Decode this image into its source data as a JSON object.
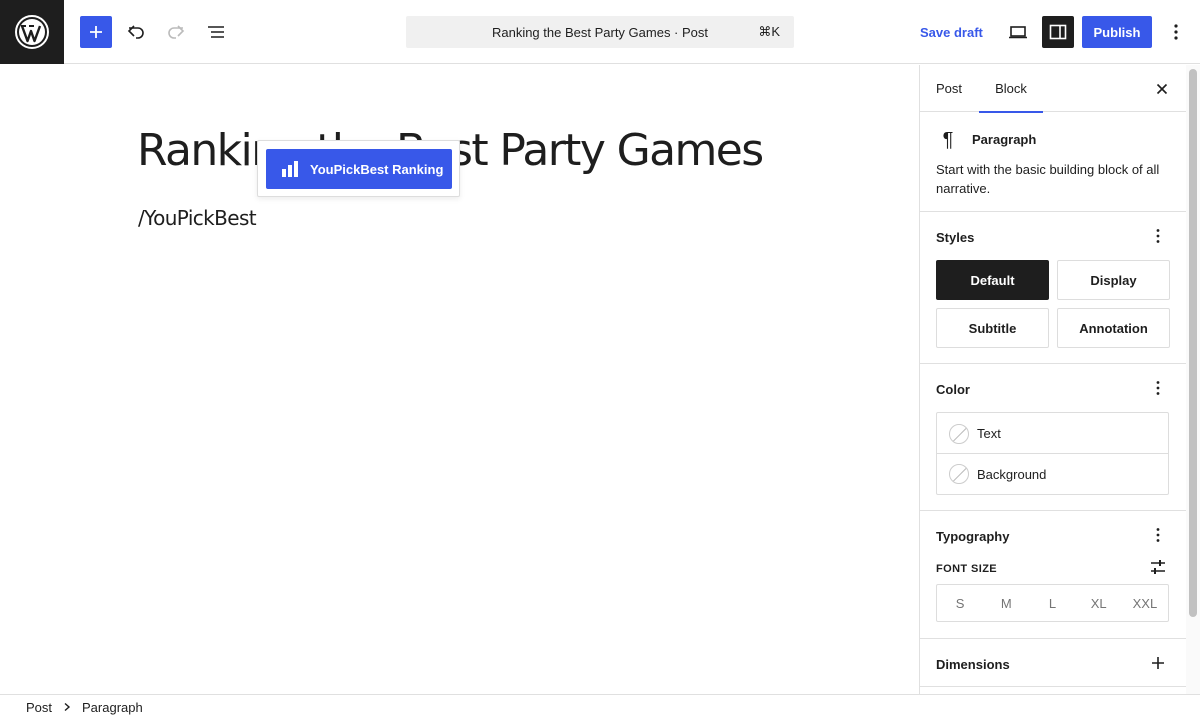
{
  "topbar": {
    "command_title": "Ranking the Best Party Games · Post",
    "shortcut": "⌘K",
    "save_draft": "Save draft",
    "publish": "Publish",
    "icons": [
      "wordpress-logo-icon",
      "plus-icon",
      "undo-icon",
      "redo-icon",
      "list-view-icon",
      "desktop-preview-icon",
      "sidebar-settings-icon",
      "more-vertical-icon"
    ]
  },
  "canvas": {
    "title": "Ranking the Best Party Games",
    "paragraph": "/YouPickBest",
    "inserter": {
      "item_label": "YouPickBest Ranking",
      "item_icon": "bar-chart-icon"
    }
  },
  "sidebar": {
    "tabs": [
      {
        "label": "Post",
        "active": false
      },
      {
        "label": "Block",
        "active": true
      }
    ],
    "accent_color": "#3858e9",
    "block": {
      "name": "Paragraph",
      "icon": "pilcrow-icon",
      "description": "Start with the basic building block of all narrative."
    },
    "styles": {
      "title": "Styles",
      "options": [
        {
          "label": "Default",
          "active": true
        },
        {
          "label": "Display",
          "active": false
        },
        {
          "label": "Subtitle",
          "active": false
        },
        {
          "label": "Annotation",
          "active": false
        }
      ]
    },
    "color": {
      "title": "Color",
      "items": [
        {
          "label": "Text"
        },
        {
          "label": "Background"
        }
      ]
    },
    "typography": {
      "title": "Typography",
      "font_size_label": "FONT SIZE",
      "sizes": [
        "S",
        "M",
        "L",
        "XL",
        "XXL"
      ]
    },
    "dimensions": {
      "title": "Dimensions"
    }
  },
  "footer": {
    "breadcrumbs": [
      "Post",
      "Paragraph"
    ]
  }
}
